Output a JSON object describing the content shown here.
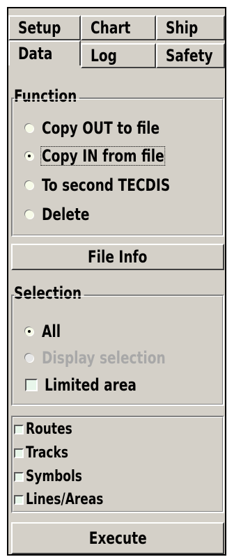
{
  "tabs": {
    "row1": [
      "Setup",
      "Chart",
      "Ship"
    ],
    "row2": [
      "Data",
      "Log",
      "Safety"
    ],
    "active": "Data"
  },
  "function_group": {
    "label": "Function",
    "options": [
      {
        "label": "Copy OUT to file",
        "checked": false
      },
      {
        "label": "Copy IN from file",
        "checked": true
      },
      {
        "label": "To second TECDIS",
        "checked": false
      },
      {
        "label": "Delete",
        "checked": false
      }
    ]
  },
  "file_info_button": "File Info",
  "selection_group": {
    "label": "Selection",
    "all_label": "All",
    "display_selection_label": "Display selection",
    "limited_area_label": "Limited area"
  },
  "object_types": [
    "Routes",
    "Tracks",
    "Symbols",
    "Lines/Areas"
  ],
  "execute_button": "Execute"
}
